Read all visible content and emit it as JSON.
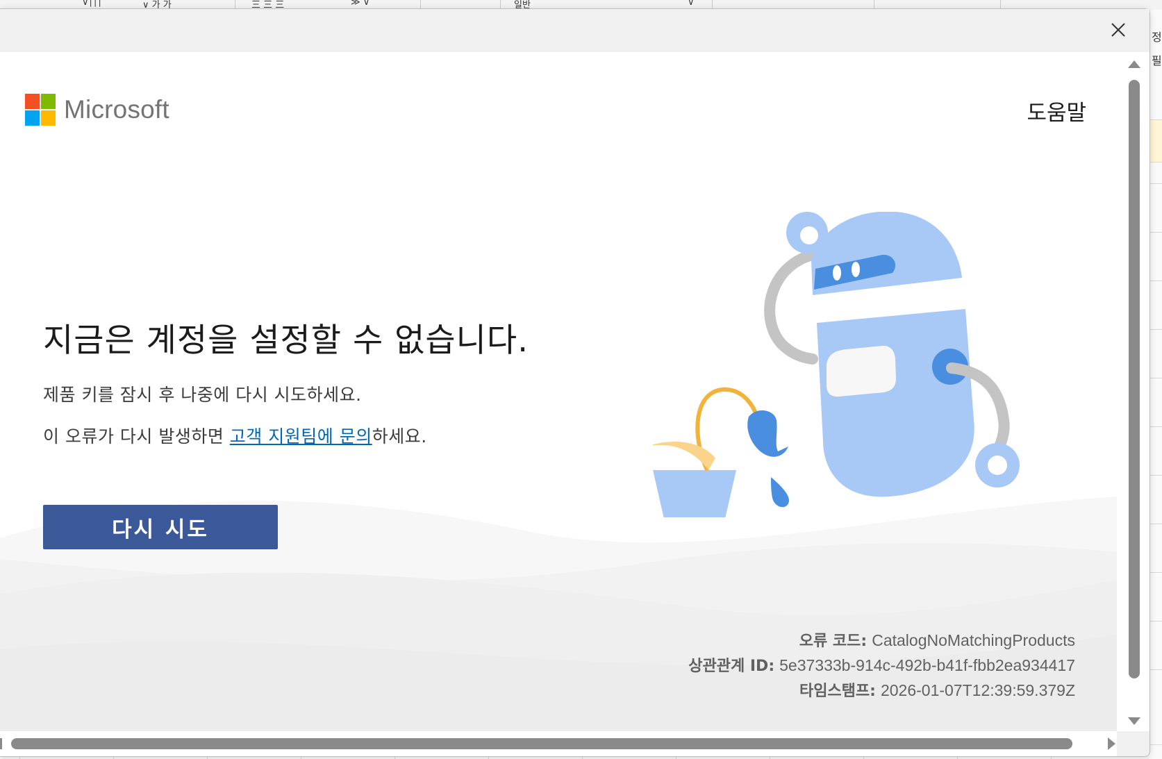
{
  "background_sheet": {
    "ribbon_fragments": [
      "∨∣∣∣",
      "∨ 가 가",
      "三 三 三",
      "≫ ∨",
      "일반",
      "∨"
    ],
    "right_edge_text": [
      "정",
      "필"
    ]
  },
  "dialog": {
    "close_icon": "close-icon",
    "brand": {
      "name": "Microsoft",
      "colors": [
        "#f25022",
        "#7fba00",
        "#00a4ef",
        "#ffb900"
      ]
    },
    "help_label": "도움말",
    "heading": "지금은 계정을 설정할 수 없습니다.",
    "message_line1": "제품 키를 잠시 후 나중에 다시 시도하세요.",
    "message_line2_prefix": "이 오류가 다시 발생하면 ",
    "support_link": "고객 지원팀에 문의",
    "message_line2_suffix": "하세요.",
    "retry_button": "다시 시도",
    "error_details": {
      "error_code_label": "오류 코드:",
      "error_code": "CatalogNoMatchingProducts",
      "correlation_label": "상관관계 ID:",
      "correlation_id": "5e37333b-914c-492b-b41f-fbb2ea934417",
      "timestamp_label": "타임스탬프:",
      "timestamp": "2026-01-07T12:39:59.379Z"
    },
    "illustration": "robot-watering-wilted-plant",
    "accent_color": "#3b5998",
    "link_color": "#0067b8"
  }
}
